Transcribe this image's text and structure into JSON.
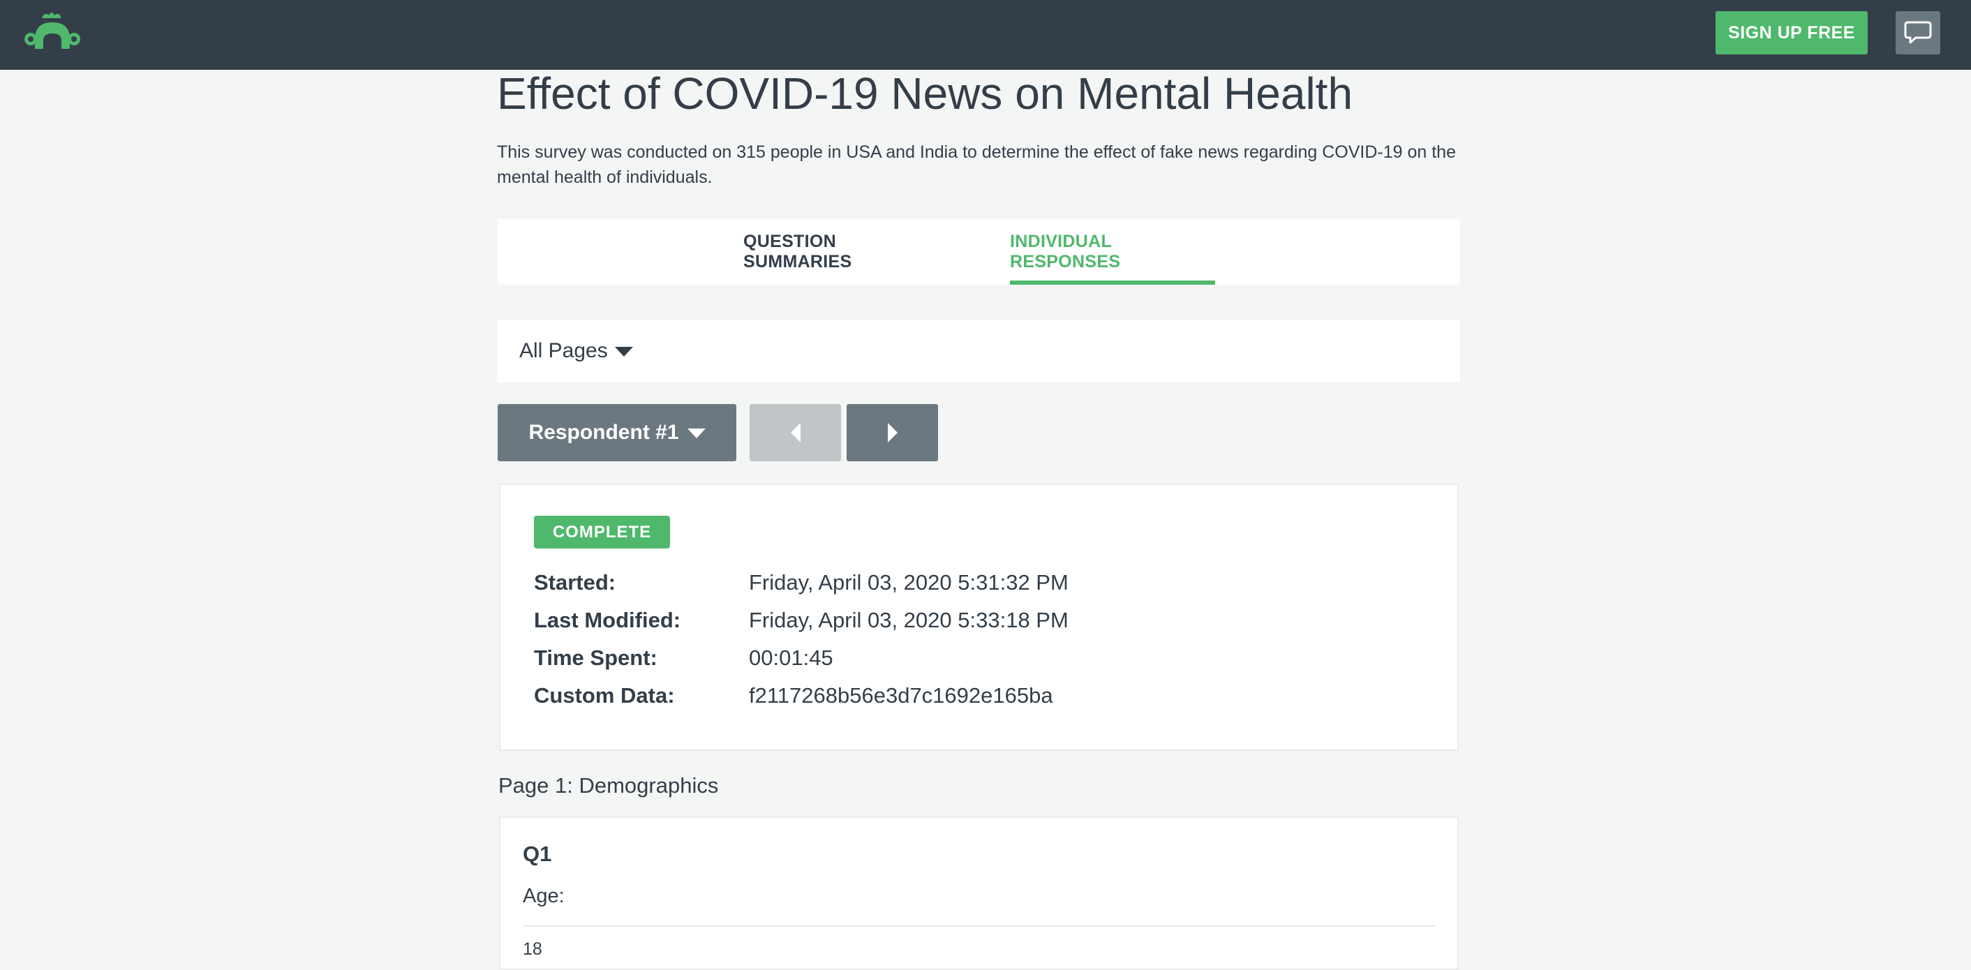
{
  "header": {
    "logo_icon": "surveymonkey-logo-icon",
    "signup_label": "SIGN UP FREE",
    "feedback_icon": "speech-bubble-icon",
    "colors": {
      "bar": "#333e48",
      "accent": "#4fb86c"
    }
  },
  "survey": {
    "title": "Effect of COVID-19 News on Mental Health",
    "description": "This survey was conducted on 315 people in USA and India to determine the effect of fake news regarding COVID-19 on the mental health of individuals."
  },
  "tabs": [
    {
      "label": "QUESTION SUMMARIES",
      "active": false
    },
    {
      "label": "INDIVIDUAL RESPONSES",
      "active": true
    }
  ],
  "filter": {
    "pages_label": "All Pages"
  },
  "respondent": {
    "selector_label": "Respondent #1",
    "prev_enabled": false,
    "next_enabled": true
  },
  "response_info": {
    "status": "COMPLETE",
    "rows": [
      {
        "label": "Started:",
        "value": "Friday, April 03, 2020 5:31:32 PM"
      },
      {
        "label": "Last Modified:",
        "value": "Friday, April 03, 2020 5:33:18 PM"
      },
      {
        "label": "Time Spent:",
        "value": "00:01:45"
      },
      {
        "label": "Custom Data:",
        "value": "f2117268b56e3d7c1692e165ba"
      }
    ]
  },
  "page_section": {
    "title": "Page 1: Demographics",
    "question": {
      "number": "Q1",
      "text": "Age:",
      "answer": "18"
    }
  }
}
